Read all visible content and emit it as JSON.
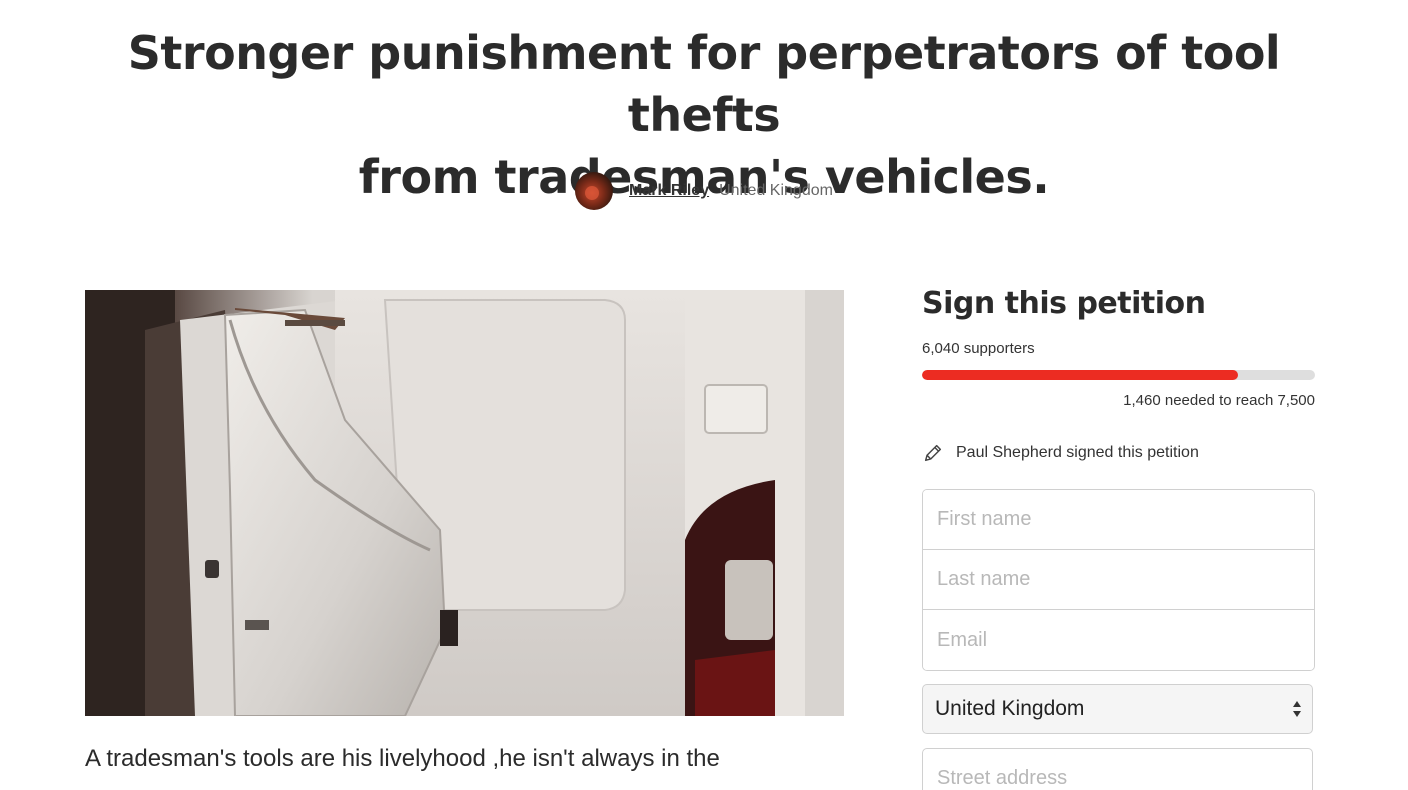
{
  "petition": {
    "title_line1": "Stronger punishment for perpetrators of tool thefts",
    "title_line2": "from tradesman's vehicles.",
    "author_name": "Mark Riley",
    "author_location": "United Kingdom",
    "hero_image_alt": "Damaged white van",
    "body_excerpt": "A tradesman's tools are his livelyhood ,he isn't always in the"
  },
  "sidebar": {
    "heading": "Sign this petition",
    "supporters_text": "6,040 supporters",
    "supporters_count": 6040,
    "goal": 7500,
    "progress_fraction": 0.8053,
    "needed_text": "1,460 needed to reach 7,500",
    "recent_signer": "Paul Shepherd signed this petition",
    "accent_color": "#ec2c22"
  },
  "form": {
    "first_name_placeholder": "First name",
    "last_name_placeholder": "Last name",
    "email_placeholder": "Email",
    "country_value": "United Kingdom",
    "street_placeholder": "Street address"
  },
  "icons": {
    "recent_signer": "pencil-icon",
    "select": "updown-arrows-icon"
  }
}
